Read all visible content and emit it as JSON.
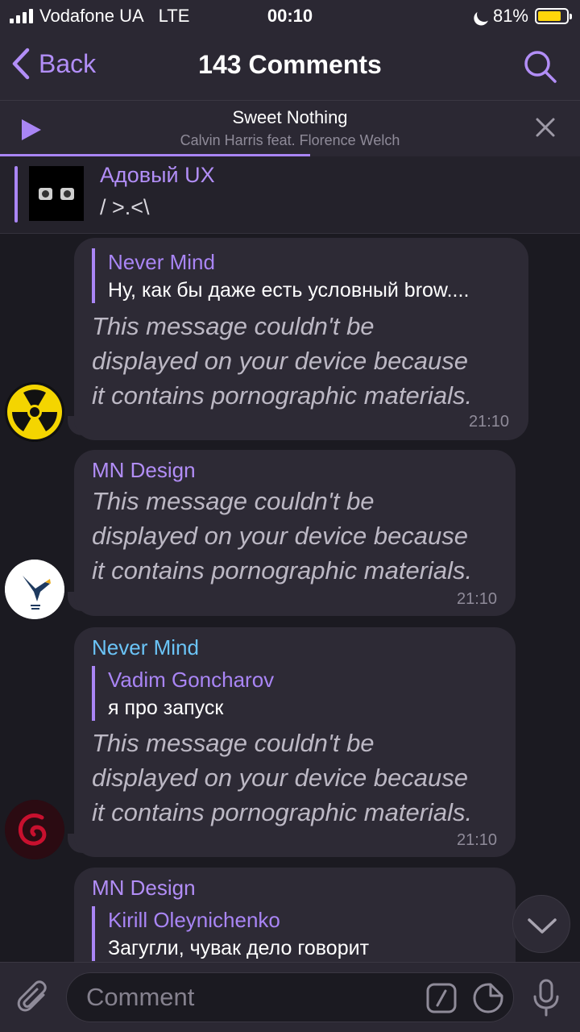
{
  "status_bar": {
    "carrier": "Vodafone UA",
    "network": "LTE",
    "time": "00:10",
    "battery_percent": "81%",
    "battery_level": 0.81,
    "battery_color": "#ffd60a"
  },
  "nav": {
    "back_label": "Back",
    "title": "143 Comments",
    "search_icon": "search-icon"
  },
  "player": {
    "song_title": "Sweet Nothing",
    "artist": "Calvin Harris feat. Florence Welch",
    "progress": 0.535,
    "accent": "#a985f5"
  },
  "pinned": {
    "name": "Адовый UX",
    "text": "/ >.<\\"
  },
  "messages": [
    {
      "reply_name": "Never Mind",
      "reply_text": "Ну, как бы даже есть условный brow....",
      "body": [
        "This message couldn't be",
        "displayed on your device because",
        "it contains pornographic materials."
      ],
      "time": "21:10"
    },
    {
      "sender": "MN Design",
      "body": [
        "This message couldn't be",
        "displayed on your device because",
        "it contains pornographic materials."
      ],
      "time": "21:10"
    },
    {
      "sender": "Never Mind",
      "reply_name": "Vadim Goncharov",
      "reply_text": "я про запуск",
      "body": [
        "This message couldn't be",
        "displayed on your device because",
        "it contains pornographic materials."
      ],
      "time": "21:10"
    },
    {
      "sender": "MN Design",
      "reply_name": "Kirill Oleynichenko",
      "reply_text": "Загугли, чувак дело говорит"
    }
  ],
  "input": {
    "placeholder": "Comment"
  }
}
